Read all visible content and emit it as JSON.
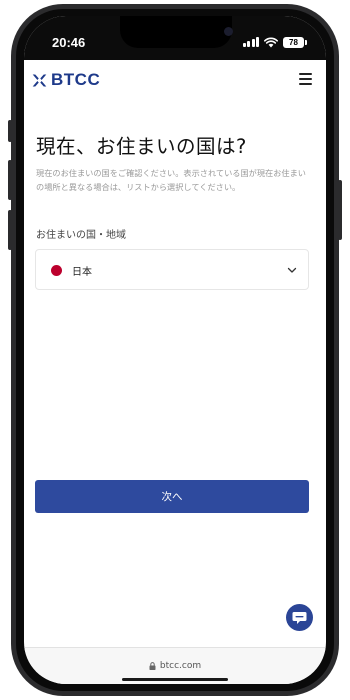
{
  "status_bar": {
    "time": "20:46",
    "battery": "78",
    "icons": [
      "signal-icon",
      "wifi-icon",
      "battery-icon"
    ]
  },
  "header": {
    "logo_text": "BTCC",
    "menu_icon": "hamburger-menu-icon"
  },
  "main": {
    "title": "現在、お住まいの国は?",
    "description": "現在のお住まいの国をご確認ください。表示されている国が現在お住まいの場所と異なる場合は、リストから選択してください。",
    "country_label": "お住まいの国・地域",
    "selected_country": "日本",
    "next_button": "次へ"
  },
  "browser": {
    "url": "btcc.com"
  },
  "colors": {
    "brand": "#1e3a8a",
    "button": "#2e4a9e",
    "flag_red": "#bc002d"
  }
}
